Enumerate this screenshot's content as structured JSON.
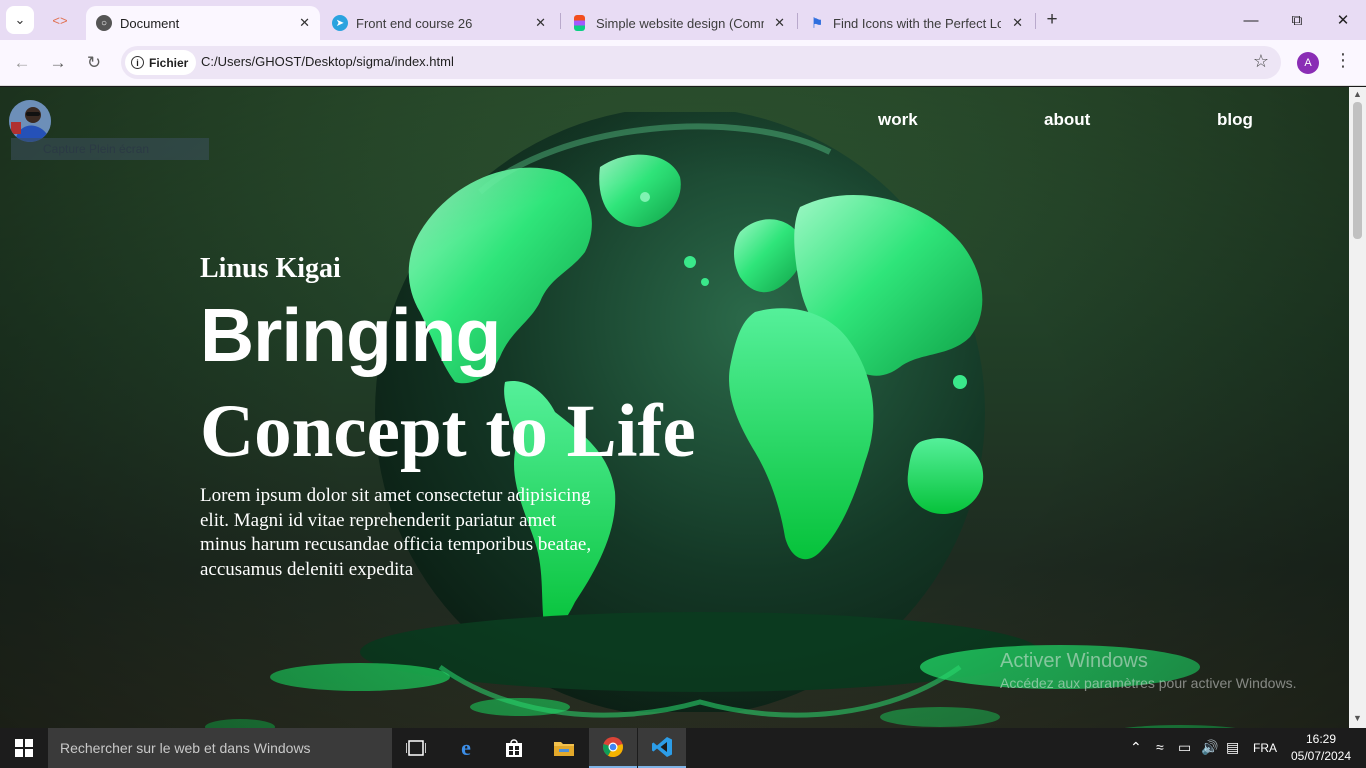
{
  "browser": {
    "tabs": [
      {
        "title": "Document",
        "active": true,
        "favicon": "globe-icon"
      },
      {
        "title": "Front end course 26",
        "active": false,
        "favicon": "telegram-icon"
      },
      {
        "title": "Simple website design (Commu",
        "active": false,
        "favicon": "figma-icon"
      },
      {
        "title": "Find Icons with the Perfect Look",
        "active": false,
        "favicon": "flag-icon"
      }
    ],
    "site_chip": "Fichier",
    "url": "C:/Users/GHOST/Desktop/sigma/index.html",
    "profile_initial": "A"
  },
  "page": {
    "capture_label": "Capture Plein écran",
    "nav": {
      "work": "work",
      "about": "about",
      "blog": "blog"
    },
    "hero": {
      "name": "Linus Kigai",
      "title_line1": "Bringing",
      "title_line2": "Concept to Life",
      "body": "Lorem ipsum dolor sit amet consectetur adipisicing elit. Magni id vitae reprehenderit pariatur amet minus harum recusandae officia temporibus beatae, accusamus deleniti expedita"
    },
    "watermark": {
      "title": "Activer Windows",
      "subtitle": "Accédez aux paramètres pour activer Windows."
    }
  },
  "taskbar": {
    "search_placeholder": "Rechercher sur le web et dans Windows",
    "language": "FRA",
    "time": "16:29",
    "date": "05/07/2024"
  },
  "colors": {
    "tab_strip": "#e8dcf4",
    "toolbar": "#fbf7ff",
    "profile": "#8a2db5",
    "globe_green": "#1fd964"
  }
}
